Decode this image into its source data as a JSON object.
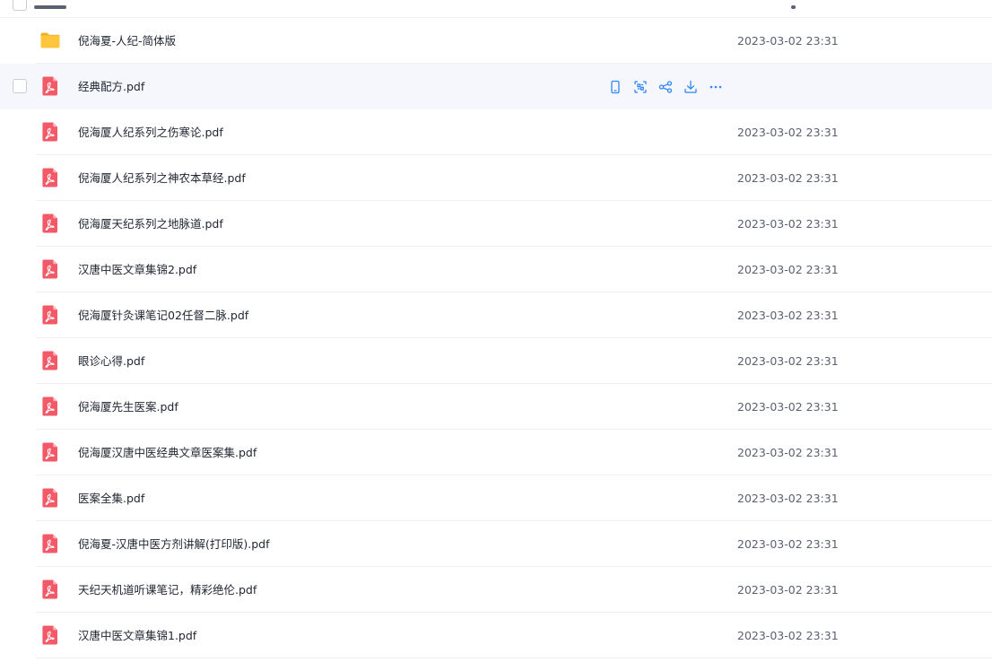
{
  "theme": {
    "accent": "#2f86f6",
    "pdf_red": "#f25a68",
    "folder_yellow": "#ffc53d"
  },
  "files": [
    {
      "name": "倪海夏-人纪-简体版",
      "type": "folder",
      "date": "2023-03-02 23:31"
    },
    {
      "name": "经典配方.pdf",
      "type": "pdf",
      "date": "",
      "hovered": true
    },
    {
      "name": "倪海厦人纪系列之伤寒论.pdf",
      "type": "pdf",
      "date": "2023-03-02 23:31"
    },
    {
      "name": "倪海厦人纪系列之神农本草经.pdf",
      "type": "pdf",
      "date": "2023-03-02 23:31"
    },
    {
      "name": "倪海厦天纪系列之地脉道.pdf",
      "type": "pdf",
      "date": "2023-03-02 23:31"
    },
    {
      "name": "汉唐中医文章集锦2.pdf",
      "type": "pdf",
      "date": "2023-03-02 23:31"
    },
    {
      "name": "倪海厦针灸课笔记02任督二脉.pdf",
      "type": "pdf",
      "date": "2023-03-02 23:31"
    },
    {
      "name": "眼诊心得.pdf",
      "type": "pdf",
      "date": "2023-03-02 23:31"
    },
    {
      "name": "倪海厦先生医案.pdf",
      "type": "pdf",
      "date": "2023-03-02 23:31"
    },
    {
      "name": "倪海厦汉唐中医经典文章医案集.pdf",
      "type": "pdf",
      "date": "2023-03-02 23:31"
    },
    {
      "name": "医案全集.pdf",
      "type": "pdf",
      "date": "2023-03-02 23:31"
    },
    {
      "name": "倪海夏-汉唐中医方剂讲解(打印版).pdf",
      "type": "pdf",
      "date": "2023-03-02 23:31"
    },
    {
      "name": "天纪天机道听课笔记，精彩绝伦.pdf",
      "type": "pdf",
      "date": "2023-03-02 23:31"
    },
    {
      "name": "汉唐中医文章集锦1.pdf",
      "type": "pdf",
      "date": "2023-03-02 23:31"
    }
  ],
  "row_actions": [
    {
      "icon": "phone-icon"
    },
    {
      "icon": "scan-icon"
    },
    {
      "icon": "share-icon"
    },
    {
      "icon": "download-icon"
    },
    {
      "icon": "more-icon"
    }
  ]
}
